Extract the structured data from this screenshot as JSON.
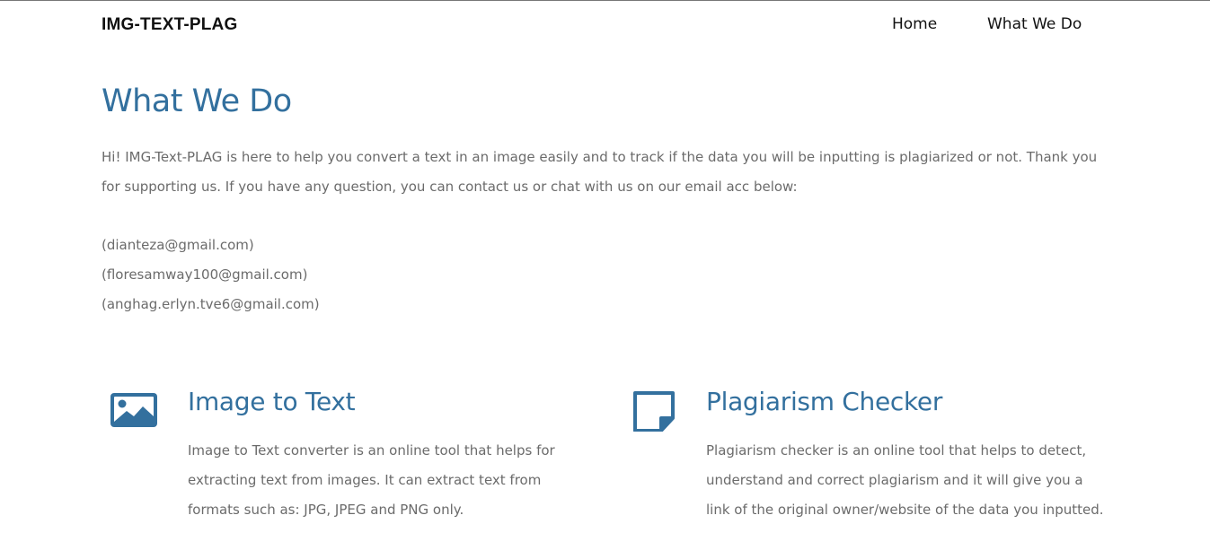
{
  "nav": {
    "brand": "IMG-TEXT-PLAG",
    "links": [
      "Home",
      "What We Do"
    ]
  },
  "main": {
    "title": "What We Do",
    "intro": "Hi! IMG-Text-PLAG is here to help you convert a text in an image easily and to track if the data you will be inputting is plagiarized or not. Thank you for supporting us. If you have any question, you can contact us or chat with us on our email acc below:",
    "emails": [
      "(dianteza@gmail.com)",
      "(floresamway100@gmail.com)",
      "(anghag.erlyn.tve6@gmail.com)"
    ]
  },
  "features": [
    {
      "icon": "image-icon",
      "title": "Image to Text",
      "description": "Image to Text converter is an online tool that helps for extracting text from images. It can extract text from formats such as: JPG, JPEG and PNG only."
    },
    {
      "icon": "sticky-note-icon",
      "title": "Plagiarism Checker",
      "description": "Plagiarism checker is an online tool that helps to detect, understand and correct plagiarism and it will give you a link of the original owner/website of the data you inputted."
    }
  ],
  "colors": {
    "accent": "#33709e",
    "text": "#6b6b6b",
    "nav_text": "#111111"
  }
}
